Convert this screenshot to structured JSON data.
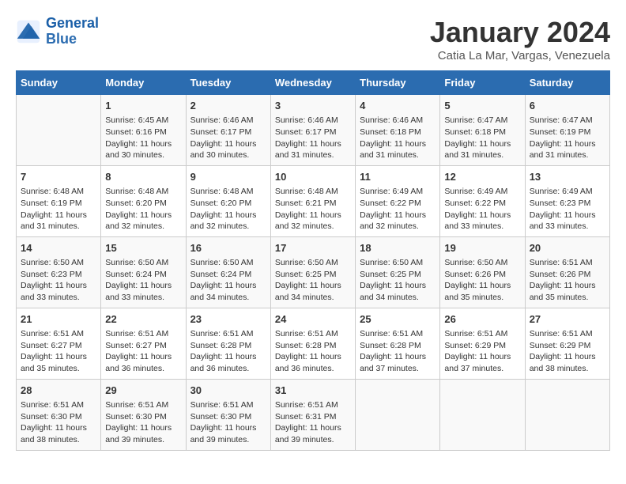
{
  "header": {
    "logo_line1": "General",
    "logo_line2": "Blue",
    "month_title": "January 2024",
    "subtitle": "Catia La Mar, Vargas, Venezuela"
  },
  "weekdays": [
    "Sunday",
    "Monday",
    "Tuesday",
    "Wednesday",
    "Thursday",
    "Friday",
    "Saturday"
  ],
  "weeks": [
    [
      {
        "day": "",
        "info": ""
      },
      {
        "day": "1",
        "info": "Sunrise: 6:45 AM\nSunset: 6:16 PM\nDaylight: 11 hours\nand 30 minutes."
      },
      {
        "day": "2",
        "info": "Sunrise: 6:46 AM\nSunset: 6:17 PM\nDaylight: 11 hours\nand 30 minutes."
      },
      {
        "day": "3",
        "info": "Sunrise: 6:46 AM\nSunset: 6:17 PM\nDaylight: 11 hours\nand 31 minutes."
      },
      {
        "day": "4",
        "info": "Sunrise: 6:46 AM\nSunset: 6:18 PM\nDaylight: 11 hours\nand 31 minutes."
      },
      {
        "day": "5",
        "info": "Sunrise: 6:47 AM\nSunset: 6:18 PM\nDaylight: 11 hours\nand 31 minutes."
      },
      {
        "day": "6",
        "info": "Sunrise: 6:47 AM\nSunset: 6:19 PM\nDaylight: 11 hours\nand 31 minutes."
      }
    ],
    [
      {
        "day": "7",
        "info": "Sunrise: 6:48 AM\nSunset: 6:19 PM\nDaylight: 11 hours\nand 31 minutes."
      },
      {
        "day": "8",
        "info": "Sunrise: 6:48 AM\nSunset: 6:20 PM\nDaylight: 11 hours\nand 32 minutes."
      },
      {
        "day": "9",
        "info": "Sunrise: 6:48 AM\nSunset: 6:20 PM\nDaylight: 11 hours\nand 32 minutes."
      },
      {
        "day": "10",
        "info": "Sunrise: 6:48 AM\nSunset: 6:21 PM\nDaylight: 11 hours\nand 32 minutes."
      },
      {
        "day": "11",
        "info": "Sunrise: 6:49 AM\nSunset: 6:22 PM\nDaylight: 11 hours\nand 32 minutes."
      },
      {
        "day": "12",
        "info": "Sunrise: 6:49 AM\nSunset: 6:22 PM\nDaylight: 11 hours\nand 33 minutes."
      },
      {
        "day": "13",
        "info": "Sunrise: 6:49 AM\nSunset: 6:23 PM\nDaylight: 11 hours\nand 33 minutes."
      }
    ],
    [
      {
        "day": "14",
        "info": "Sunrise: 6:50 AM\nSunset: 6:23 PM\nDaylight: 11 hours\nand 33 minutes."
      },
      {
        "day": "15",
        "info": "Sunrise: 6:50 AM\nSunset: 6:24 PM\nDaylight: 11 hours\nand 33 minutes."
      },
      {
        "day": "16",
        "info": "Sunrise: 6:50 AM\nSunset: 6:24 PM\nDaylight: 11 hours\nand 34 minutes."
      },
      {
        "day": "17",
        "info": "Sunrise: 6:50 AM\nSunset: 6:25 PM\nDaylight: 11 hours\nand 34 minutes."
      },
      {
        "day": "18",
        "info": "Sunrise: 6:50 AM\nSunset: 6:25 PM\nDaylight: 11 hours\nand 34 minutes."
      },
      {
        "day": "19",
        "info": "Sunrise: 6:50 AM\nSunset: 6:26 PM\nDaylight: 11 hours\nand 35 minutes."
      },
      {
        "day": "20",
        "info": "Sunrise: 6:51 AM\nSunset: 6:26 PM\nDaylight: 11 hours\nand 35 minutes."
      }
    ],
    [
      {
        "day": "21",
        "info": "Sunrise: 6:51 AM\nSunset: 6:27 PM\nDaylight: 11 hours\nand 35 minutes."
      },
      {
        "day": "22",
        "info": "Sunrise: 6:51 AM\nSunset: 6:27 PM\nDaylight: 11 hours\nand 36 minutes."
      },
      {
        "day": "23",
        "info": "Sunrise: 6:51 AM\nSunset: 6:28 PM\nDaylight: 11 hours\nand 36 minutes."
      },
      {
        "day": "24",
        "info": "Sunrise: 6:51 AM\nSunset: 6:28 PM\nDaylight: 11 hours\nand 36 minutes."
      },
      {
        "day": "25",
        "info": "Sunrise: 6:51 AM\nSunset: 6:28 PM\nDaylight: 11 hours\nand 37 minutes."
      },
      {
        "day": "26",
        "info": "Sunrise: 6:51 AM\nSunset: 6:29 PM\nDaylight: 11 hours\nand 37 minutes."
      },
      {
        "day": "27",
        "info": "Sunrise: 6:51 AM\nSunset: 6:29 PM\nDaylight: 11 hours\nand 38 minutes."
      }
    ],
    [
      {
        "day": "28",
        "info": "Sunrise: 6:51 AM\nSunset: 6:30 PM\nDaylight: 11 hours\nand 38 minutes."
      },
      {
        "day": "29",
        "info": "Sunrise: 6:51 AM\nSunset: 6:30 PM\nDaylight: 11 hours\nand 39 minutes."
      },
      {
        "day": "30",
        "info": "Sunrise: 6:51 AM\nSunset: 6:30 PM\nDaylight: 11 hours\nand 39 minutes."
      },
      {
        "day": "31",
        "info": "Sunrise: 6:51 AM\nSunset: 6:31 PM\nDaylight: 11 hours\nand 39 minutes."
      },
      {
        "day": "",
        "info": ""
      },
      {
        "day": "",
        "info": ""
      },
      {
        "day": "",
        "info": ""
      }
    ]
  ]
}
